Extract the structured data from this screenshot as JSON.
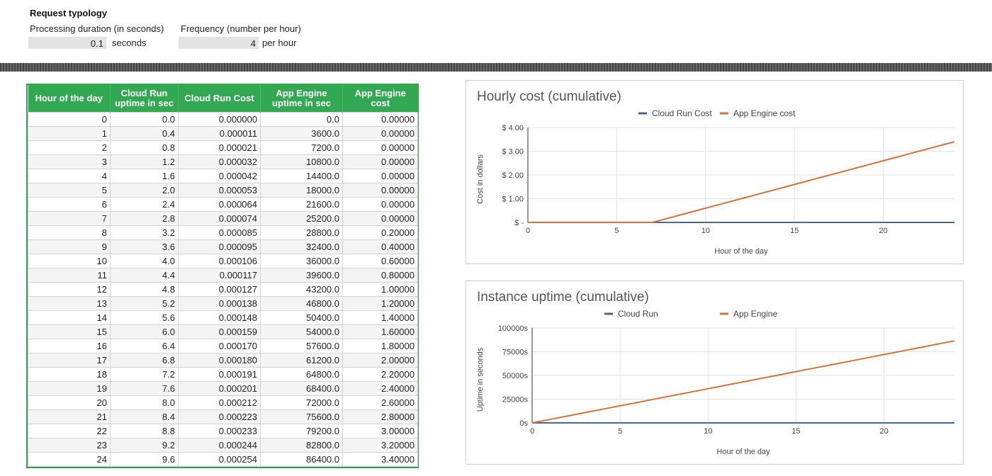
{
  "typology": {
    "title": "Request typology",
    "duration_label": "Processing duration (in seconds)",
    "duration_value": "0.1",
    "duration_unit": "seconds",
    "frequency_label": "Frequency (number per hour)",
    "frequency_value": "4",
    "frequency_unit": "per hour"
  },
  "table": {
    "headers": [
      "Hour of the day",
      "Cloud Run uptime in sec",
      "Cloud Run Cost",
      "App Engine uptime in sec",
      "App Engine cost"
    ],
    "rows": [
      [
        "0",
        "0.0",
        "0.000000",
        "0.0",
        "0.00000"
      ],
      [
        "1",
        "0.4",
        "0.000011",
        "3600.0",
        "0.00000"
      ],
      [
        "2",
        "0.8",
        "0.000021",
        "7200.0",
        "0.00000"
      ],
      [
        "3",
        "1.2",
        "0.000032",
        "10800.0",
        "0.00000"
      ],
      [
        "4",
        "1.6",
        "0.000042",
        "14400.0",
        "0.00000"
      ],
      [
        "5",
        "2.0",
        "0.000053",
        "18000.0",
        "0.00000"
      ],
      [
        "6",
        "2.4",
        "0.000064",
        "21600.0",
        "0.00000"
      ],
      [
        "7",
        "2.8",
        "0.000074",
        "25200.0",
        "0.00000"
      ],
      [
        "8",
        "3.2",
        "0.000085",
        "28800.0",
        "0.20000"
      ],
      [
        "9",
        "3.6",
        "0.000095",
        "32400.0",
        "0.40000"
      ],
      [
        "10",
        "4.0",
        "0.000106",
        "36000.0",
        "0.60000"
      ],
      [
        "11",
        "4.4",
        "0.000117",
        "39600.0",
        "0.80000"
      ],
      [
        "12",
        "4.8",
        "0.000127",
        "43200.0",
        "1.00000"
      ],
      [
        "13",
        "5.2",
        "0.000138",
        "46800.0",
        "1.20000"
      ],
      [
        "14",
        "5.6",
        "0.000148",
        "50400.0",
        "1.40000"
      ],
      [
        "15",
        "6.0",
        "0.000159",
        "54000.0",
        "1.60000"
      ],
      [
        "16",
        "6.4",
        "0.000170",
        "57600.0",
        "1.80000"
      ],
      [
        "17",
        "6.8",
        "0.000180",
        "61200.0",
        "2.00000"
      ],
      [
        "18",
        "7.2",
        "0.000191",
        "64800.0",
        "2.20000"
      ],
      [
        "19",
        "7.6",
        "0.000201",
        "68400.0",
        "2.40000"
      ],
      [
        "20",
        "8.0",
        "0.000212",
        "72000.0",
        "2.60000"
      ],
      [
        "21",
        "8.4",
        "0.000223",
        "75600.0",
        "2.80000"
      ],
      [
        "22",
        "8.8",
        "0.000233",
        "79200.0",
        "3.00000"
      ],
      [
        "23",
        "9.2",
        "0.000244",
        "82800.0",
        "3.20000"
      ],
      [
        "24",
        "9.6",
        "0.000254",
        "86400.0",
        "3.40000"
      ]
    ]
  },
  "chart_data": [
    {
      "type": "line",
      "title": "Hourly cost (cumulative)",
      "xlabel": "Hour of the day",
      "ylabel": "Cost in dollars",
      "x": [
        0,
        1,
        2,
        3,
        4,
        5,
        6,
        7,
        8,
        9,
        10,
        11,
        12,
        13,
        14,
        15,
        16,
        17,
        18,
        19,
        20,
        21,
        22,
        23,
        24
      ],
      "xlim": [
        0,
        24
      ],
      "ylim": [
        0,
        4
      ],
      "x_ticks": [
        0,
        5,
        10,
        15,
        20
      ],
      "y_ticks": [
        0,
        1,
        2,
        3,
        4
      ],
      "y_tick_labels": [
        "$ -",
        "$ 1.00",
        "$ 2.00",
        "$ 3.00",
        "$ 4.00"
      ],
      "grid": true,
      "legend_position": "top",
      "series": [
        {
          "name": "Cloud Run Cost",
          "color": "#4a6a8a",
          "values": [
            0,
            1.1e-05,
            2.1e-05,
            3.2e-05,
            4.2e-05,
            5.3e-05,
            6.4e-05,
            7.4e-05,
            8.5e-05,
            9.5e-05,
            0.000106,
            0.000117,
            0.000127,
            0.000138,
            0.000148,
            0.000159,
            0.00017,
            0.00018,
            0.000191,
            0.000201,
            0.000212,
            0.000223,
            0.000233,
            0.000244,
            0.000254
          ]
        },
        {
          "name": "App Engine cost",
          "color": "#d4733a",
          "values": [
            0,
            0,
            0,
            0,
            0,
            0,
            0,
            0,
            0.2,
            0.4,
            0.6,
            0.8,
            1.0,
            1.2,
            1.4,
            1.6,
            1.8,
            2.0,
            2.2,
            2.4,
            2.6,
            2.8,
            3.0,
            3.2,
            3.4
          ]
        }
      ]
    },
    {
      "type": "line",
      "title": "Instance uptime (cumulative)",
      "xlabel": "Hour of the day",
      "ylabel": "Uptime in seconds",
      "x": [
        0,
        1,
        2,
        3,
        4,
        5,
        6,
        7,
        8,
        9,
        10,
        11,
        12,
        13,
        14,
        15,
        16,
        17,
        18,
        19,
        20,
        21,
        22,
        23,
        24
      ],
      "xlim": [
        0,
        24
      ],
      "ylim": [
        0,
        100000
      ],
      "x_ticks": [
        0,
        5,
        10,
        15,
        20
      ],
      "y_ticks": [
        0,
        25000,
        50000,
        75000,
        100000
      ],
      "y_tick_labels": [
        "0s",
        "25000s",
        "50000s",
        "75000s",
        "100000s"
      ],
      "grid": true,
      "legend_position": "top",
      "series": [
        {
          "name": "Cloud Run",
          "color": "#4a6a8a",
          "values": [
            0,
            0.4,
            0.8,
            1.2,
            1.6,
            2.0,
            2.4,
            2.8,
            3.2,
            3.6,
            4.0,
            4.4,
            4.8,
            5.2,
            5.6,
            6.0,
            6.4,
            6.8,
            7.2,
            7.6,
            8.0,
            8.4,
            8.8,
            9.2,
            9.6
          ]
        },
        {
          "name": "App Engine",
          "color": "#d4733a",
          "values": [
            0,
            3600,
            7200,
            10800,
            14400,
            18000,
            21600,
            25200,
            28800,
            32400,
            36000,
            39600,
            43200,
            46800,
            50400,
            54000,
            57600,
            61200,
            64800,
            68400,
            72000,
            75600,
            79200,
            82800,
            86400
          ]
        }
      ]
    }
  ]
}
